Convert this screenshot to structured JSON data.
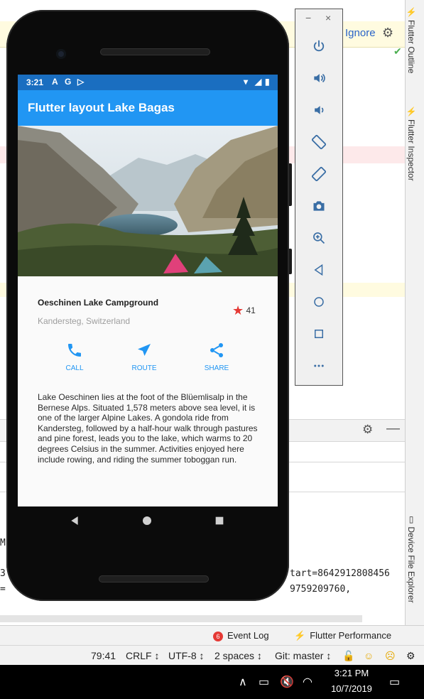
{
  "ide": {
    "notification_action": "Ignore",
    "console_lines": [
      {
        "text": "M"
      },
      {
        "text": "3"
      },
      {
        "text": "="
      },
      {
        "text": "tart=8642912808456"
      },
      {
        "text": "9759209760,"
      }
    ],
    "side_tabs": [
      {
        "label": "Flutter Outline"
      },
      {
        "label": "Flutter Inspector"
      },
      {
        "label": "Device File Explorer"
      }
    ],
    "bottom_tools": {
      "event_log_count": "6",
      "event_log": "Event Log",
      "flutter_performance": "Flutter Performance"
    },
    "status_bar": {
      "position": "79:41",
      "line_sep": "CRLF ↕",
      "encoding": "UTF-8 ↕",
      "indent": "2 spaces ↕",
      "git": "Git: master ↕"
    }
  },
  "taskbar": {
    "time": "3:21 PM",
    "date": "10/7/2019"
  },
  "emulator_panel": {
    "window_controls": [
      "−",
      "×"
    ],
    "buttons": [
      {
        "name": "power-button",
        "icon": "power-icon"
      },
      {
        "name": "volume-up-button",
        "icon": "volume-up-icon"
      },
      {
        "name": "volume-down-button",
        "icon": "volume-down-icon"
      },
      {
        "name": "rotate-left-button",
        "icon": "rotate-left-icon"
      },
      {
        "name": "rotate-right-button",
        "icon": "rotate-right-icon"
      },
      {
        "name": "screenshot-button",
        "icon": "camera-icon"
      },
      {
        "name": "zoom-button",
        "icon": "zoom-in-icon"
      },
      {
        "name": "back-button",
        "icon": "back-triangle-icon"
      },
      {
        "name": "home-button",
        "icon": "home-circle-icon"
      },
      {
        "name": "overview-button",
        "icon": "overview-square-icon"
      },
      {
        "name": "more-button",
        "icon": "more-dots-icon"
      }
    ]
  },
  "phone": {
    "status_time": "3:21",
    "app_title": "Flutter layout Lake Bagas",
    "place_name": "Oeschinen Lake Campground",
    "place_location": "Kandersteg, Switzerland",
    "favorite_count": "41",
    "actions": [
      {
        "label": "CALL",
        "icon": "phone-icon"
      },
      {
        "label": "ROUTE",
        "icon": "navigation-arrow-icon"
      },
      {
        "label": "SHARE",
        "icon": "share-icon"
      }
    ],
    "description": "Lake Oeschinen lies at the foot of the Blüemlisalp in the Bernese Alps. Situated 1,578 meters above sea level, it is one of the larger Alpine Lakes. A gondola ride from Kandersteg, followed by a half-hour walk through pastures and pine forest, leads you to the lake, which warms to 20 degrees Celsius in the summer. Activities enjoyed here include rowing, and riding the summer toboggan run.",
    "accent_color": "#2196F3",
    "star_color": "#E53935"
  }
}
